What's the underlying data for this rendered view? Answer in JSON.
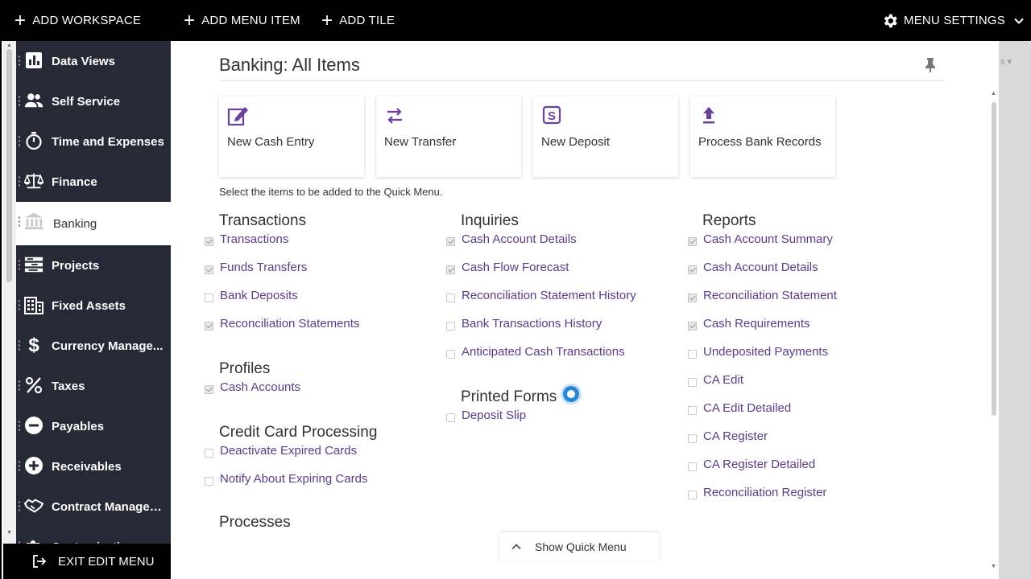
{
  "topbar": {
    "add_workspace": "ADD WORKSPACE",
    "add_menu_item": "ADD MENU ITEM",
    "add_tile": "ADD TILE",
    "menu_settings": "MENU SETTINGS"
  },
  "sidebar": {
    "items": [
      {
        "label": "Data Views",
        "icon": "bar-chart-icon"
      },
      {
        "label": "Self Service",
        "icon": "people-icon"
      },
      {
        "label": "Time and Expenses",
        "icon": "stopwatch-icon"
      },
      {
        "label": "Finance",
        "icon": "scales-icon"
      },
      {
        "label": "Banking",
        "icon": "bank-icon",
        "active": true
      },
      {
        "label": "Projects",
        "icon": "projects-icon"
      },
      {
        "label": "Fixed Assets",
        "icon": "building-icon"
      },
      {
        "label": "Currency Manage...",
        "icon": "dollar-icon"
      },
      {
        "label": "Taxes",
        "icon": "percent-icon"
      },
      {
        "label": "Payables",
        "icon": "minus-circle-icon"
      },
      {
        "label": "Receivables",
        "icon": "plus-circle-icon"
      },
      {
        "label": "Contract Managem...",
        "icon": "handshake-icon"
      },
      {
        "label": "Customization",
        "icon": "puzzle-icon"
      }
    ],
    "exit_label": "EXIT EDIT MENU"
  },
  "underlay": {
    "text": "s ▾"
  },
  "main": {
    "title": "Banking: All Items",
    "tiles": [
      {
        "label": "New Cash Entry",
        "icon": "edit-icon"
      },
      {
        "label": "New Transfer",
        "icon": "transfer-arrows-icon"
      },
      {
        "label": "New Deposit",
        "icon": "deposit-icon"
      },
      {
        "label": "Process Bank Records",
        "icon": "upload-icon"
      }
    ],
    "hint": "Select the items to be added to the Quick Menu.",
    "sections": {
      "transactions": {
        "title": "Transactions",
        "items": [
          {
            "label": "Transactions",
            "checked": true
          },
          {
            "label": "Funds Transfers",
            "checked": true
          },
          {
            "label": "Bank Deposits",
            "checked": false
          },
          {
            "label": "Reconciliation Statements",
            "checked": true
          }
        ]
      },
      "profiles": {
        "title": "Profiles",
        "items": [
          {
            "label": "Cash Accounts",
            "checked": true
          }
        ]
      },
      "credit_card": {
        "title": "Credit Card Processing",
        "items": [
          {
            "label": "Deactivate Expired Cards",
            "checked": false
          },
          {
            "label": "Notify About Expiring Cards",
            "checked": false
          }
        ]
      },
      "processes": {
        "title": "Processes"
      },
      "inquiries": {
        "title": "Inquiries",
        "items": [
          {
            "label": "Cash Account Details",
            "checked": true
          },
          {
            "label": "Cash Flow Forecast",
            "checked": true
          },
          {
            "label": "Reconciliation Statement History",
            "checked": false
          },
          {
            "label": "Bank Transactions History",
            "checked": false
          },
          {
            "label": "Anticipated Cash Transactions",
            "checked": false
          }
        ]
      },
      "printed_forms": {
        "title": "Printed Forms",
        "items": [
          {
            "label": "Deposit Slip",
            "checked": false
          }
        ]
      },
      "reports": {
        "title": "Reports",
        "items": [
          {
            "label": "Cash Account Summary",
            "checked": true
          },
          {
            "label": "Cash Account Details",
            "checked": true
          },
          {
            "label": "Reconciliation Statement",
            "checked": true
          },
          {
            "label": "Cash Requirements",
            "checked": true
          },
          {
            "label": "Undeposited Payments",
            "checked": false
          },
          {
            "label": "CA Edit",
            "checked": false
          },
          {
            "label": "CA Edit Detailed",
            "checked": false
          },
          {
            "label": "CA Register",
            "checked": false
          },
          {
            "label": "CA Register Detailed",
            "checked": false
          },
          {
            "label": "Reconciliation Register",
            "checked": false
          }
        ]
      }
    },
    "quick_menu_label": "Show Quick Menu"
  },
  "colors": {
    "topbar": "#000000",
    "sidebar": "#262a36",
    "link": "#5c3b8a",
    "accent_icon": "#6b3fa0",
    "loader": "#2a87d6"
  }
}
